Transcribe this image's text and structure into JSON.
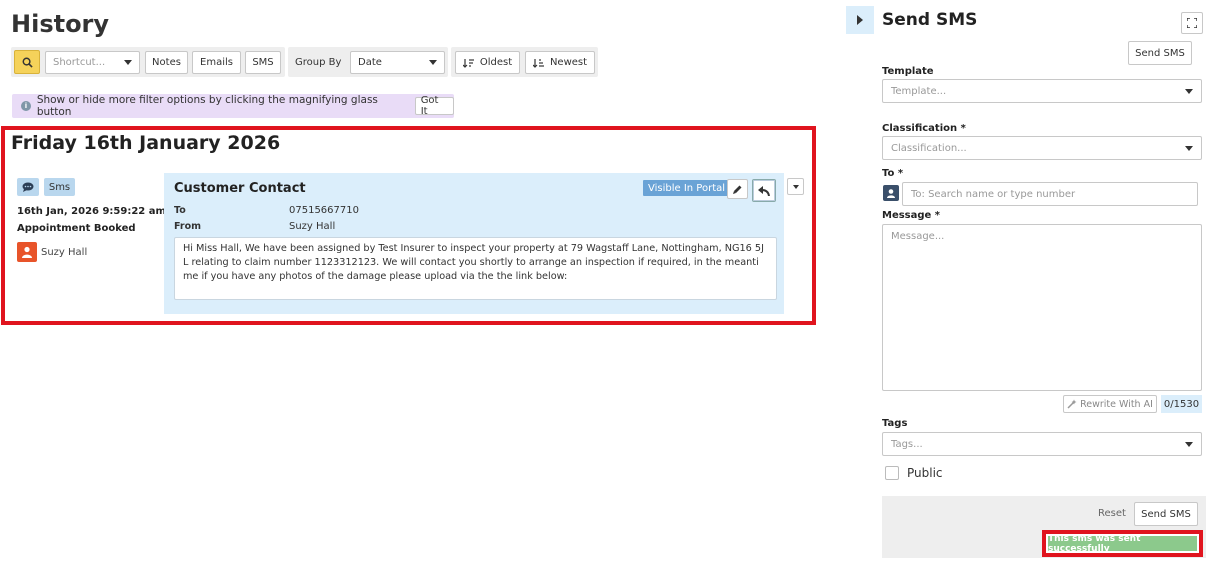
{
  "history": {
    "title": "History",
    "toolbar": {
      "search_icon": "magnifier-icon",
      "shortcut_placeholder": "Shortcut...",
      "notes_label": "Notes",
      "emails_label": "Emails",
      "sms_label": "SMS",
      "group_by_label": "Group By",
      "group_by_value": "Date",
      "oldest_label": "Oldest",
      "newest_label": "Newest"
    },
    "hint": {
      "text": "Show or hide more filter options by clicking the magnifying glass button",
      "button": "Got It"
    },
    "day_title": "Friday 16th January 2026",
    "entry": {
      "type_chip": "Sms",
      "datetime": "16th Jan, 2026 9:59:22 am",
      "status": "Appointment Booked",
      "user": "Suzy Hall",
      "card_title": "Customer Contact",
      "visible_badge": "Visible In Portal",
      "to_label": "To",
      "to_value": "07515667710",
      "from_label": "From",
      "from_value": "Suzy Hall",
      "message": "Hi Miss Hall, We have been assigned by Test Insurer to inspect your property at 79 Wagstaff Lane, Nottingham, NG16 5JL relating to claim number 1123312123. We will contact you shortly to arrange an inspection if required, in the meantime if you have any photos of the damage please upload via the the link below:"
    }
  },
  "send_sms": {
    "title": "Send SMS",
    "send_button_top": "Send SMS",
    "template_label": "Template",
    "template_placeholder": "Template...",
    "classification_label": "Classification *",
    "classification_placeholder": "Classification...",
    "to_label": "To *",
    "to_placeholder": "To: Search name or type number",
    "message_label": "Message *",
    "message_placeholder": "Message...",
    "rewrite_label": "Rewrite With AI",
    "counter": "0/1530",
    "tags_label": "Tags",
    "tags_placeholder": "Tags...",
    "public_label": "Public",
    "reset_label": "Reset",
    "send_button_bottom": "Send SMS",
    "success_message": "This sms was sent successfully"
  },
  "colors": {
    "accent_yellow": "#f5d25a",
    "card_blue": "#dbeefb",
    "highlight_red": "#e0141e",
    "success_green": "#8cc98c",
    "hint_purple": "#e9dcf7"
  }
}
